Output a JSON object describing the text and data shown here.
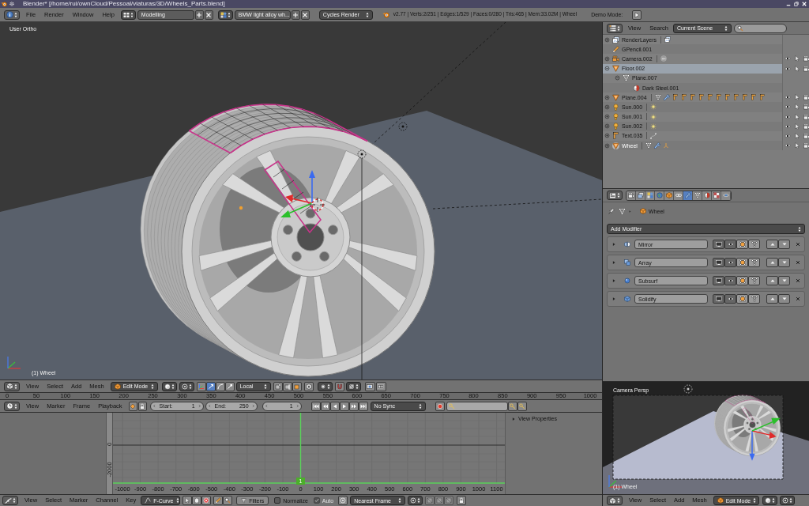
{
  "title_bar": {
    "title": "Blender* [/home/rui/ownCloud/Pessoal/viaturas/3D/Wheels_Parts.blend]"
  },
  "info_header": {
    "menus": [
      "File",
      "Render",
      "Window",
      "Help"
    ],
    "layout": "Modelling",
    "scene": "BMW light alloy wh...",
    "engine": "Cycles Render",
    "stats": "v2.77 | Verts:2/251 | Edges:1/529 | Faces:0/280 | Tris:465 | Mem:33.02M | Wheel",
    "demo_mode": "Demo Mode:"
  },
  "viewport": {
    "view_name": "User Ortho",
    "object_name": "(1) Wheel"
  },
  "viewport_header": {
    "menus": [
      "View",
      "Select",
      "Add",
      "Mesh"
    ],
    "mode": "Edit Mode",
    "manipulator_tools": [
      {
        "kind": "translate",
        "on": true
      },
      {
        "kind": "rotate",
        "on": false
      },
      {
        "kind": "scale",
        "on": false
      }
    ],
    "orientation": "Local"
  },
  "timeline": {
    "ruler": [
      "0",
      "50",
      "100",
      "150",
      "200",
      "250",
      "300",
      "350",
      "400",
      "450",
      "500",
      "550",
      "600",
      "650",
      "700",
      "750",
      "800",
      "850",
      "900",
      "950",
      "1000"
    ],
    "menus": [
      "View",
      "Marker",
      "Frame",
      "Playback"
    ],
    "start_label": "Start:",
    "start": "1",
    "end_label": "End:",
    "end": "250",
    "current_frame": "1",
    "sync": "No Sync"
  },
  "graph_editor": {
    "y_ticks": [
      "0",
      "-2000"
    ],
    "x_ticks": [
      "-1000",
      "-900",
      "-800",
      "-700",
      "-600",
      "-500",
      "-400",
      "-300",
      "-200",
      "-100",
      "0",
      "100",
      "200",
      "300",
      "400",
      "500",
      "600",
      "700",
      "800",
      "900",
      "1000",
      "1100"
    ],
    "current_frame": "1",
    "side_panel": "View Properties"
  },
  "graph_header": {
    "menus": [
      "View",
      "Select",
      "Marker",
      "Channel",
      "Key"
    ],
    "mode": "F-Curve",
    "filters": "Filters",
    "options": [
      {
        "label": "Normalize",
        "checked": false,
        "disabled": false
      },
      {
        "label": "Auto",
        "checked": true,
        "disabled": true
      }
    ],
    "snap": "Nearest Frame"
  },
  "outliner": {
    "menus": [
      "View",
      "Search"
    ],
    "display_mode": "Current Scene",
    "items": [
      {
        "name": "RenderLayers",
        "kind": "render_layers",
        "expanded": false,
        "selected": false,
        "active": false,
        "restrict": false,
        "extras": [
          {
            "kind": "render_layers"
          }
        ]
      },
      {
        "name": "GPencil.001",
        "kind": "gpencil",
        "selected": false,
        "active": false,
        "restrict": false
      },
      {
        "name": "Camera.002",
        "kind": "camera",
        "expanded": false,
        "selected": false,
        "active": false,
        "restrict": true,
        "extras": [
          {
            "kind": "camera_data"
          }
        ]
      },
      {
        "name": "Floor.002",
        "kind": "mesh",
        "expanded": true,
        "selected": true,
        "active": false,
        "restrict": true,
        "children": [
          {
            "name": "Plane.007",
            "kind": "mesh_data",
            "expanded": true,
            "selected": false,
            "active": false,
            "restrict": false,
            "children": [
              {
                "name": "Dark Steel.001",
                "kind": "material",
                "selected": false,
                "active": false,
                "restrict": false
              }
            ]
          }
        ]
      },
      {
        "name": "Plane.004",
        "kind": "mesh",
        "expanded": false,
        "selected": false,
        "active": false,
        "restrict": true,
        "extras": [
          {
            "kind": "mesh_data"
          },
          {
            "kind": "modifier"
          },
          {
            "kind": "text_data"
          },
          {
            "kind": "text_data"
          },
          {
            "kind": "text_data"
          },
          {
            "kind": "text_data"
          },
          {
            "kind": "text_data"
          },
          {
            "kind": "text_data"
          },
          {
            "kind": "text_data"
          },
          {
            "kind": "text_data"
          },
          {
            "kind": "text_data"
          },
          {
            "kind": "text_data"
          },
          {
            "kind": "text_data"
          }
        ]
      },
      {
        "name": "Sun.000",
        "kind": "lamp",
        "expanded": false,
        "selected": false,
        "active": false,
        "restrict": true,
        "extras": [
          {
            "kind": "lamp_data"
          }
        ]
      },
      {
        "name": "Sun.001",
        "kind": "lamp",
        "expanded": false,
        "selected": false,
        "active": false,
        "restrict": true,
        "extras": [
          {
            "kind": "lamp_data"
          }
        ]
      },
      {
        "name": "Sun.002",
        "kind": "lamp",
        "expanded": false,
        "selected": false,
        "active": false,
        "restrict": true,
        "extras": [
          {
            "kind": "lamp_data"
          }
        ]
      },
      {
        "name": "Text.035",
        "kind": "text",
        "expanded": false,
        "selected": false,
        "active": false,
        "restrict": true,
        "extras": [
          {
            "kind": "curve_data"
          }
        ]
      },
      {
        "name": "Wheel",
        "kind": "mesh",
        "expanded": false,
        "selected": false,
        "active": true,
        "restrict": true,
        "extras": [
          {
            "kind": "mesh_data"
          },
          {
            "kind": "modifier"
          },
          {
            "kind": "armature"
          }
        ]
      }
    ]
  },
  "properties": {
    "tabs": [
      {
        "kind": "render",
        "selected": false
      },
      {
        "kind": "render_layers",
        "selected": false
      },
      {
        "kind": "scene",
        "selected": false
      },
      {
        "kind": "world",
        "selected": false
      },
      {
        "kind": "object",
        "selected": false
      },
      {
        "kind": "constraints",
        "selected": false
      },
      {
        "kind": "modifiers",
        "selected": true
      },
      {
        "kind": "data",
        "selected": false
      },
      {
        "kind": "material",
        "selected": false
      },
      {
        "kind": "texture",
        "selected": false
      },
      {
        "kind": "physics",
        "selected": false
      }
    ],
    "context": "Wheel",
    "add_modifier": "Add Modifier",
    "modifiers": [
      {
        "name": "Mirror",
        "kind": "mirror",
        "expanded": false
      },
      {
        "name": "Array",
        "kind": "array",
        "expanded": false
      },
      {
        "name": "Subsurf",
        "kind": "subsurf",
        "expanded": false
      },
      {
        "name": "Solidify",
        "kind": "solidify",
        "expanded": false
      }
    ]
  },
  "camera_view": {
    "view_name": "Camera Persp",
    "object_name": "(1) Wheel"
  },
  "camera_header": {
    "menus": [
      "View",
      "Select",
      "Add",
      "Mesh"
    ],
    "mode": "Edit Mode"
  }
}
